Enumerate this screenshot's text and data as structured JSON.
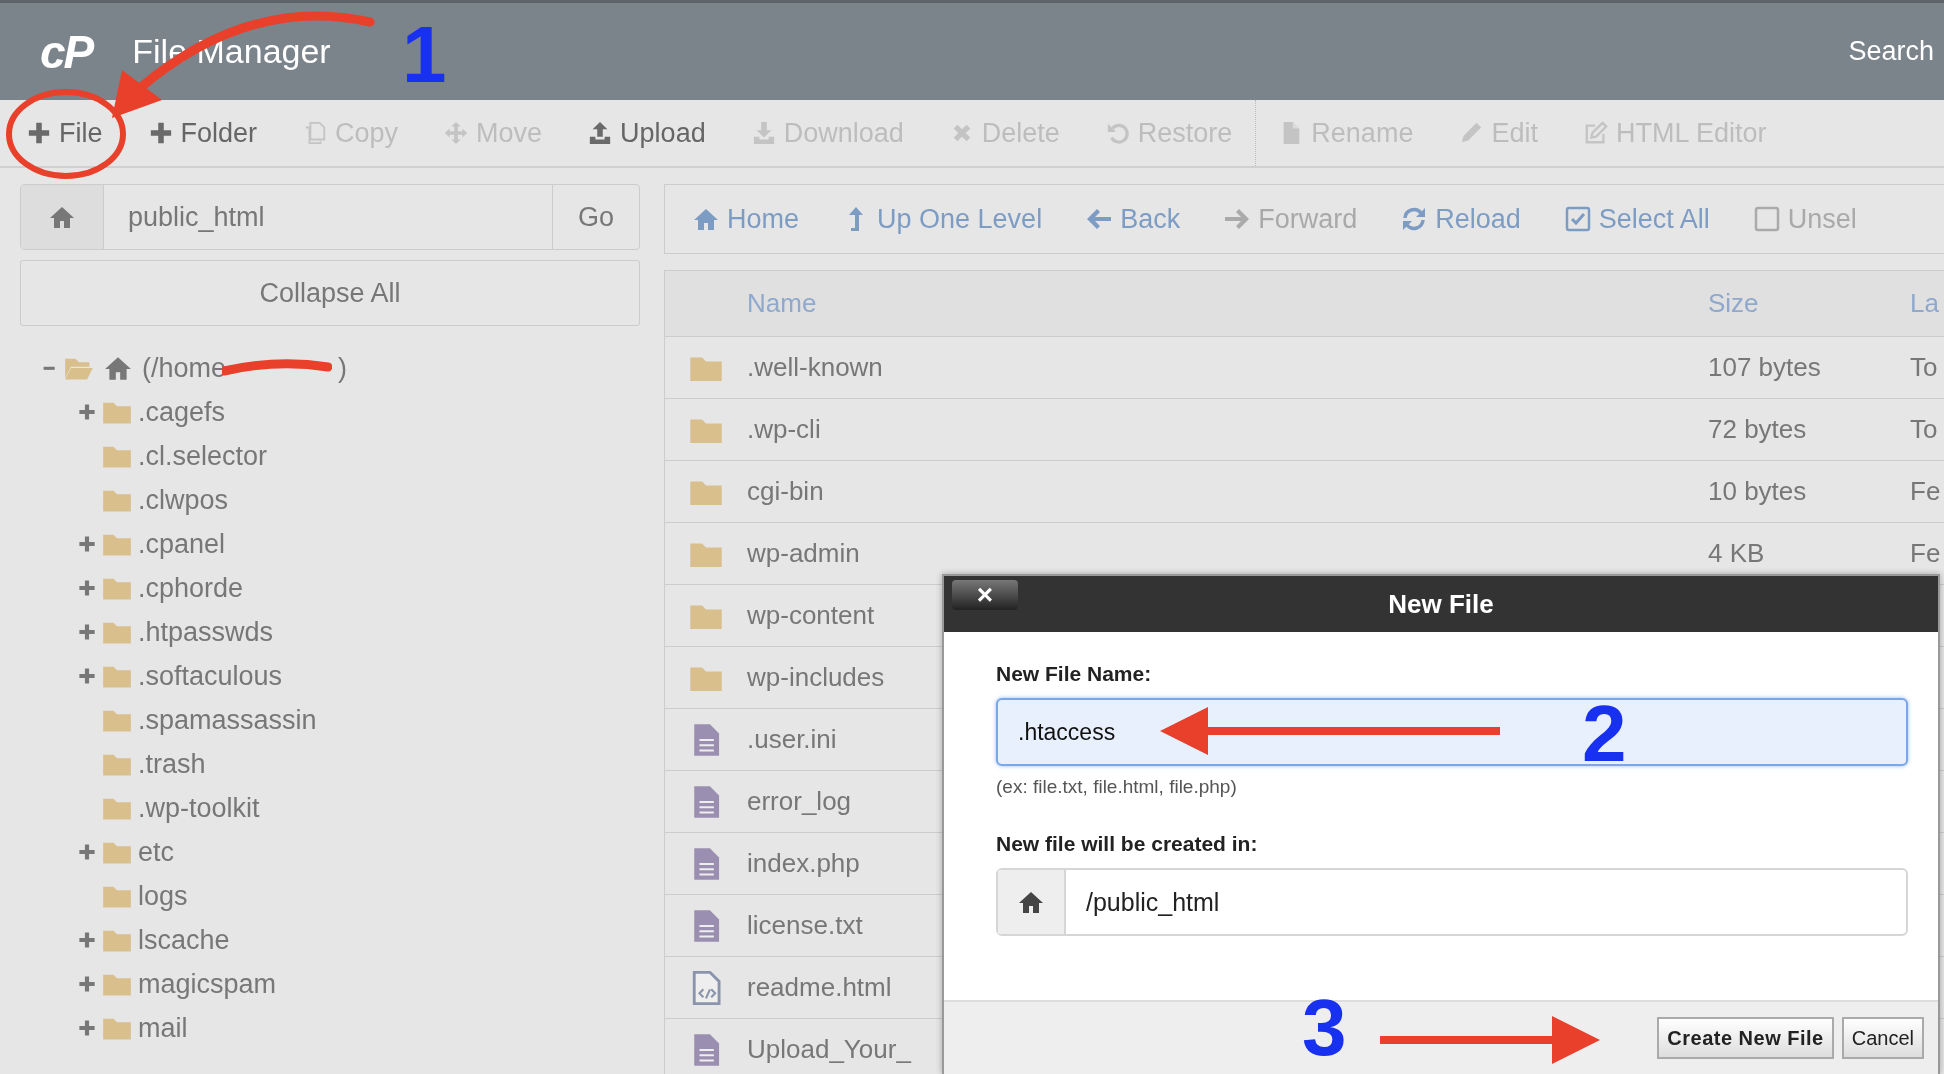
{
  "header": {
    "logo": "cP",
    "title": "File Manager",
    "search": "Search"
  },
  "toolbar": {
    "groups": [
      [
        {
          "label": "File",
          "disabled": false
        },
        {
          "label": "Folder",
          "disabled": false
        },
        {
          "label": "Copy",
          "disabled": true
        },
        {
          "label": "Move",
          "disabled": true
        },
        {
          "label": "Upload",
          "disabled": false
        },
        {
          "label": "Download",
          "disabled": true
        },
        {
          "label": "Delete",
          "disabled": true
        },
        {
          "label": "Restore",
          "disabled": true
        }
      ],
      [
        {
          "label": "Rename",
          "disabled": true
        },
        {
          "label": "Edit",
          "disabled": true
        },
        {
          "label": "HTML Editor",
          "disabled": true
        }
      ]
    ]
  },
  "path_bar": {
    "value": "public_html",
    "button": "Go"
  },
  "collapse_button": "Collapse All",
  "tree": {
    "label": "(/home",
    "closing": ")",
    "redacted": true,
    "expanded": true,
    "children": [
      {
        "label": ".cagefs",
        "expandable": true
      },
      {
        "label": ".cl.selector",
        "expandable": false
      },
      {
        "label": ".clwpos",
        "expandable": false
      },
      {
        "label": ".cpanel",
        "expandable": true
      },
      {
        "label": ".cphorde",
        "expandable": true
      },
      {
        "label": ".htpasswds",
        "expandable": true
      },
      {
        "label": ".softaculous",
        "expandable": true
      },
      {
        "label": ".spamassassin",
        "expandable": false
      },
      {
        "label": ".trash",
        "expandable": false
      },
      {
        "label": ".wp-toolkit",
        "expandable": false
      },
      {
        "label": "etc",
        "expandable": true
      },
      {
        "label": "logs",
        "expandable": false
      },
      {
        "label": "lscache",
        "expandable": true
      },
      {
        "label": "magicspam",
        "expandable": true
      },
      {
        "label": "mail",
        "expandable": true
      }
    ]
  },
  "nav": [
    {
      "label": "Home",
      "disabled": false
    },
    {
      "label": "Up One Level",
      "disabled": false
    },
    {
      "label": "Back",
      "disabled": false
    },
    {
      "label": "Forward",
      "disabled": true
    },
    {
      "label": "Reload",
      "disabled": false
    },
    {
      "label": "Select All",
      "disabled": false
    },
    {
      "label": "Unsel",
      "disabled": true
    }
  ],
  "table": {
    "columns": [
      "Name",
      "Size",
      "La"
    ],
    "rows": [
      {
        "kind": "folder",
        "name": ".well-known",
        "size": "107 bytes",
        "column_3": "To"
      },
      {
        "kind": "folder",
        "name": ".wp-cli",
        "size": "72 bytes",
        "column_3": "To"
      },
      {
        "kind": "folder",
        "name": "cgi-bin",
        "size": "10 bytes",
        "column_3": "Fe"
      },
      {
        "kind": "folder",
        "name": "wp-admin",
        "size": "4 KB",
        "column_3": "Fe"
      },
      {
        "kind": "folder",
        "name": "wp-content"
      },
      {
        "kind": "folder",
        "name": "wp-includes"
      },
      {
        "kind": "file",
        "name": ".user.ini"
      },
      {
        "kind": "file",
        "name": "error_log"
      },
      {
        "kind": "file",
        "name": "index.php"
      },
      {
        "kind": "file",
        "name": "license.txt"
      },
      {
        "kind": "html",
        "name": "readme.html"
      },
      {
        "kind": "file",
        "name": "Upload_Your_"
      }
    ]
  },
  "dialog": {
    "title": "New File",
    "close": "×",
    "name_label": "New File Name:",
    "name_value": ".htaccess",
    "name_focused": true,
    "hint": "(ex: file.txt, file.html, file.php)",
    "dir_label": "New file will be created in:",
    "dir_value": "/public_html",
    "buttons": [
      {
        "label": "Create New File",
        "primary": true
      },
      {
        "label": "Cancel",
        "primary": false
      }
    ]
  },
  "annotations": [
    {
      "kind": "circle"
    },
    {
      "kind": "curved_arrow"
    },
    {
      "kind": "number",
      "text": "1"
    },
    {
      "kind": "left_arrow"
    },
    {
      "kind": "number",
      "text": "2"
    },
    {
      "kind": "number",
      "text": "3"
    },
    {
      "kind": "right_arrow"
    }
  ]
}
